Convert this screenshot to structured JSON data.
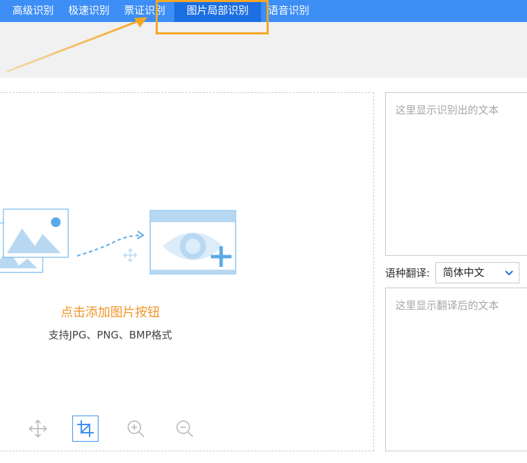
{
  "tabs": [
    {
      "label": "高级识别"
    },
    {
      "label": "极速识别"
    },
    {
      "label": "票证识别"
    },
    {
      "label": "图片局部识别"
    },
    {
      "label": "语音识别"
    }
  ],
  "upload": {
    "add_label": "点击添加图片按钮",
    "formats_label": "支持JPG、PNG、BMP格式"
  },
  "toolbar": {
    "tools": [
      "move-icon",
      "crop-icon",
      "zoom-in-icon",
      "zoom-out-icon"
    ]
  },
  "result": {
    "placeholder": "这里显示识别出的文本"
  },
  "translate": {
    "label": "语种翻译:",
    "selected": "简体中文",
    "placeholder": "这里显示翻译后的文本"
  },
  "colors": {
    "tabbar": "#3d8ef5",
    "tab_active": "#1c6fe3",
    "highlight": "#f5a623",
    "add_text": "#f0952a"
  }
}
